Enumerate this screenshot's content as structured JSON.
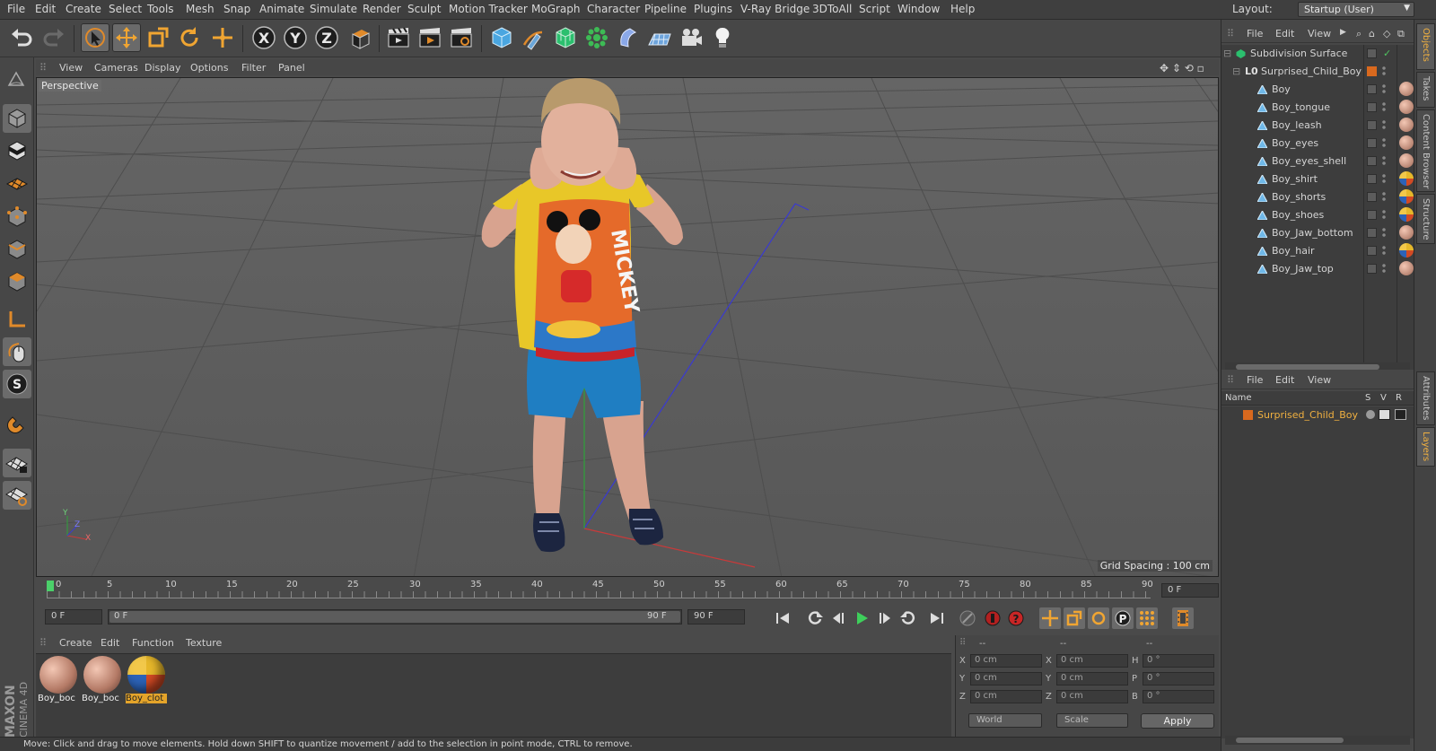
{
  "menubar": {
    "items": [
      "File",
      "Edit",
      "Create",
      "Select",
      "Tools",
      "Mesh",
      "Snap",
      "Animate",
      "Simulate",
      "Render",
      "Sculpt",
      "Motion Tracker",
      "MoGraph",
      "Character",
      "Pipeline",
      "Plugins",
      "V-Ray Bridge",
      "3DToAll",
      "Script",
      "Window",
      "Help"
    ],
    "layout_label": "Layout:",
    "layout_value": "Startup (User)"
  },
  "viewport": {
    "menu": [
      "View",
      "Cameras",
      "Display",
      "Options",
      "Filter",
      "Panel"
    ],
    "camera_label": "Perspective",
    "grid_spacing": "Grid Spacing : 100 cm",
    "axis_labels": {
      "y": "Y",
      "z": "Z",
      "x": "X"
    }
  },
  "timeline": {
    "ticks": [
      "0",
      "5",
      "10",
      "15",
      "20",
      "25",
      "30",
      "35",
      "40",
      "45",
      "50",
      "55",
      "60",
      "65",
      "70",
      "75",
      "80",
      "85",
      "90"
    ],
    "current_frame_field": "0 F",
    "start_field": "0 F",
    "range_start": "0 F",
    "range_end": "90 F",
    "end_field": "90 F"
  },
  "materials": {
    "menu": [
      "Create",
      "Edit",
      "Function",
      "Texture"
    ],
    "items": [
      {
        "label": "Boy_boc",
        "selected": false
      },
      {
        "label": "Boy_boc",
        "selected": false
      },
      {
        "label": "Boy_clot",
        "selected": true
      }
    ]
  },
  "coordinates": {
    "headers": [
      "--",
      "--",
      "--"
    ],
    "rows": [
      {
        "a_label": "X",
        "a_val": "0 cm",
        "b_label": "X",
        "b_val": "0 cm",
        "c_label": "H",
        "c_val": "0 °"
      },
      {
        "a_label": "Y",
        "a_val": "0 cm",
        "b_label": "Y",
        "b_val": "0 cm",
        "c_label": "P",
        "c_val": "0 °"
      },
      {
        "a_label": "Z",
        "a_val": "0 cm",
        "b_label": "Z",
        "b_val": "0 cm",
        "c_label": "B",
        "c_val": "0 °"
      }
    ],
    "space_select": "World",
    "mode_select": "Scale",
    "apply_label": "Apply"
  },
  "status_text": "Move: Click and drag to move elements. Hold down SHIFT to quantize movement / add to the selection in point mode, CTRL to remove.",
  "objects_panel": {
    "menu": [
      "File",
      "Edit",
      "View"
    ],
    "items": [
      {
        "name": "Subdivision Surface",
        "indent": 0,
        "type": "subdivision"
      },
      {
        "name": "Surprised_Child_Boy",
        "indent": 1,
        "type": "null"
      },
      {
        "name": "Boy",
        "indent": 2,
        "type": "mesh"
      },
      {
        "name": "Boy_tongue",
        "indent": 2,
        "type": "mesh"
      },
      {
        "name": "Boy_leash",
        "indent": 2,
        "type": "mesh"
      },
      {
        "name": "Boy_eyes",
        "indent": 2,
        "type": "mesh"
      },
      {
        "name": "Boy_eyes_shell",
        "indent": 2,
        "type": "mesh"
      },
      {
        "name": "Boy_shirt",
        "indent": 2,
        "type": "mesh"
      },
      {
        "name": "Boy_shorts",
        "indent": 2,
        "type": "mesh"
      },
      {
        "name": "Boy_shoes",
        "indent": 2,
        "type": "mesh"
      },
      {
        "name": "Boy_Jaw_bottom",
        "indent": 2,
        "type": "mesh"
      },
      {
        "name": "Boy_hair",
        "indent": 2,
        "type": "mesh"
      },
      {
        "name": "Boy_Jaw_top",
        "indent": 2,
        "type": "mesh"
      }
    ]
  },
  "layers_panel": {
    "menu": [
      "File",
      "Edit",
      "View"
    ],
    "columns": {
      "name": "Name",
      "s": "S",
      "v": "V",
      "r": "R"
    },
    "layer_name": "Surprised_Child_Boy",
    "layer_color": "#d9691e"
  },
  "side_tabs": [
    "Objects",
    "Takes",
    "Content Browser",
    "Structure",
    "Attributes",
    "Layers"
  ],
  "brand": {
    "line1": "MAXON",
    "line2": "CINEMA 4D"
  },
  "colors": {
    "accent": "#e4a42a",
    "selected_layer_text": "#f0b040"
  }
}
